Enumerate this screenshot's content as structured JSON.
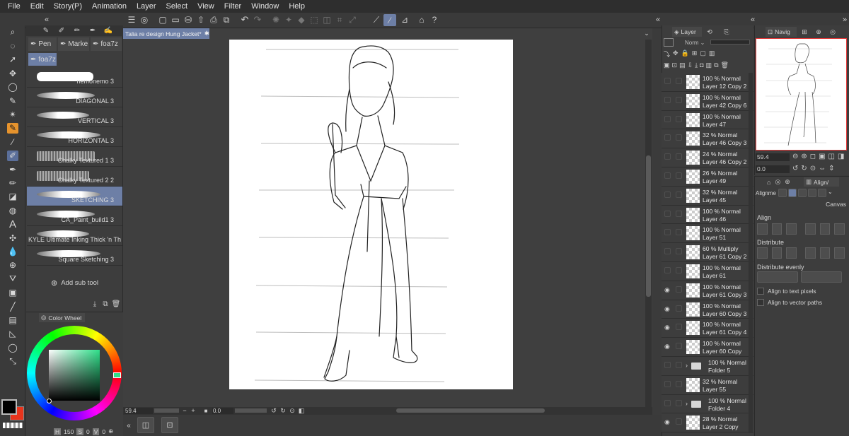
{
  "menu": [
    "File",
    "Edit",
    "Story(P)",
    "Animation",
    "Layer",
    "Select",
    "View",
    "Filter",
    "Window",
    "Help"
  ],
  "document_tab": "Talia re design Hung Jacket*",
  "subtool_tabs": [
    "Pen",
    "Marke",
    "foa7z"
  ],
  "active_subtool_group": "foa7z",
  "brushes": [
    {
      "name": "nemonemo 3",
      "selected": false
    },
    {
      "name": "DIAGONAL 3",
      "selected": false
    },
    {
      "name": "VERTICAL 3",
      "selected": false
    },
    {
      "name": "HORIZONTAL 3",
      "selected": false
    },
    {
      "name": "Chalky Textured 1 3",
      "selected": false
    },
    {
      "name": "Chalky Textured 2 2",
      "selected": false
    },
    {
      "name": "SKETCHING 3",
      "selected": true
    },
    {
      "name": "CA_Paint_build1 3",
      "selected": false
    },
    {
      "name": "KYLE Ultimate Inking Thick 'n Th",
      "selected": false
    },
    {
      "name": "Square Sketching 3",
      "selected": false
    }
  ],
  "add_sub_tool": "Add sub tool",
  "color_wheel_tab": "Color Wheel",
  "color_values": {
    "h": "H",
    "h_val": "150",
    "s": "S",
    "s_val": "0",
    "v": "V",
    "v_val": "0"
  },
  "colors": {
    "accent": "#e6932d",
    "selection": "#6d7fa6",
    "main_color": "#000000",
    "sub_color": "#e8341c"
  },
  "canvas_status": {
    "zoom": "59.4",
    "angle": "0.0"
  },
  "layer_panel": {
    "tab": "Layer",
    "blend_mode": "Norm",
    "layers": [
      {
        "opacity": "100 %",
        "mode": "Normal",
        "name": "Layer 12 Copy 2",
        "visible": false,
        "folder": false
      },
      {
        "opacity": "100 %",
        "mode": "Normal",
        "name": "Layer 42 Copy 6",
        "visible": false,
        "folder": false
      },
      {
        "opacity": "100 %",
        "mode": "Normal",
        "name": "Layer 47",
        "visible": false,
        "folder": false
      },
      {
        "opacity": "32 %",
        "mode": "Normal",
        "name": "Layer 46 Copy 3",
        "visible": false,
        "folder": false
      },
      {
        "opacity": "24 %",
        "mode": "Normal",
        "name": "Layer 46 Copy 2",
        "visible": false,
        "folder": false
      },
      {
        "opacity": "26 %",
        "mode": "Normal",
        "name": "Layer 49",
        "visible": false,
        "folder": false
      },
      {
        "opacity": "32 %",
        "mode": "Normal",
        "name": "Layer 45",
        "visible": false,
        "folder": false
      },
      {
        "opacity": "100 %",
        "mode": "Normal",
        "name": "Layer 46",
        "visible": false,
        "folder": false
      },
      {
        "opacity": "100 %",
        "mode": "Normal",
        "name": "Layer 51",
        "visible": false,
        "folder": false
      },
      {
        "opacity": "60 %",
        "mode": "Multiply",
        "name": "Layer 61 Copy 2",
        "visible": false,
        "folder": false
      },
      {
        "opacity": "100 %",
        "mode": "Normal",
        "name": "Layer 61",
        "visible": false,
        "folder": false
      },
      {
        "opacity": "100 %",
        "mode": "Normal",
        "name": "Layer 61 Copy 3",
        "visible": true,
        "folder": false
      },
      {
        "opacity": "100 %",
        "mode": "Normal",
        "name": "Layer 60 Copy 3",
        "visible": true,
        "folder": false
      },
      {
        "opacity": "100 %",
        "mode": "Normal",
        "name": "Layer 61 Copy 4",
        "visible": true,
        "folder": false
      },
      {
        "opacity": "100 %",
        "mode": "Normal",
        "name": "Layer 60 Copy",
        "visible": true,
        "folder": false
      },
      {
        "opacity": "100 %",
        "mode": "Normal",
        "name": "Folder 5",
        "visible": false,
        "folder": true
      },
      {
        "opacity": "32 %",
        "mode": "Normal",
        "name": "Layer 55",
        "visible": false,
        "folder": false
      },
      {
        "opacity": "100 %",
        "mode": "Normal",
        "name": "Folder 4",
        "visible": false,
        "folder": true
      },
      {
        "opacity": "28 %",
        "mode": "Normal",
        "name": "Layer 2 Copy",
        "visible": true,
        "folder": false
      }
    ]
  },
  "navigator": {
    "tab": "Navig",
    "zoom": "59.4",
    "angle": "0.0"
  },
  "align_panel": {
    "tab": "Align/",
    "alignment_label": "Alignme",
    "target": "Canvas",
    "align": "Align",
    "distribute": "Distribute",
    "distribute_evenly": "Distribute evenly",
    "align_text": "Align to text pixels",
    "align_vector": "Align to vector paths"
  }
}
